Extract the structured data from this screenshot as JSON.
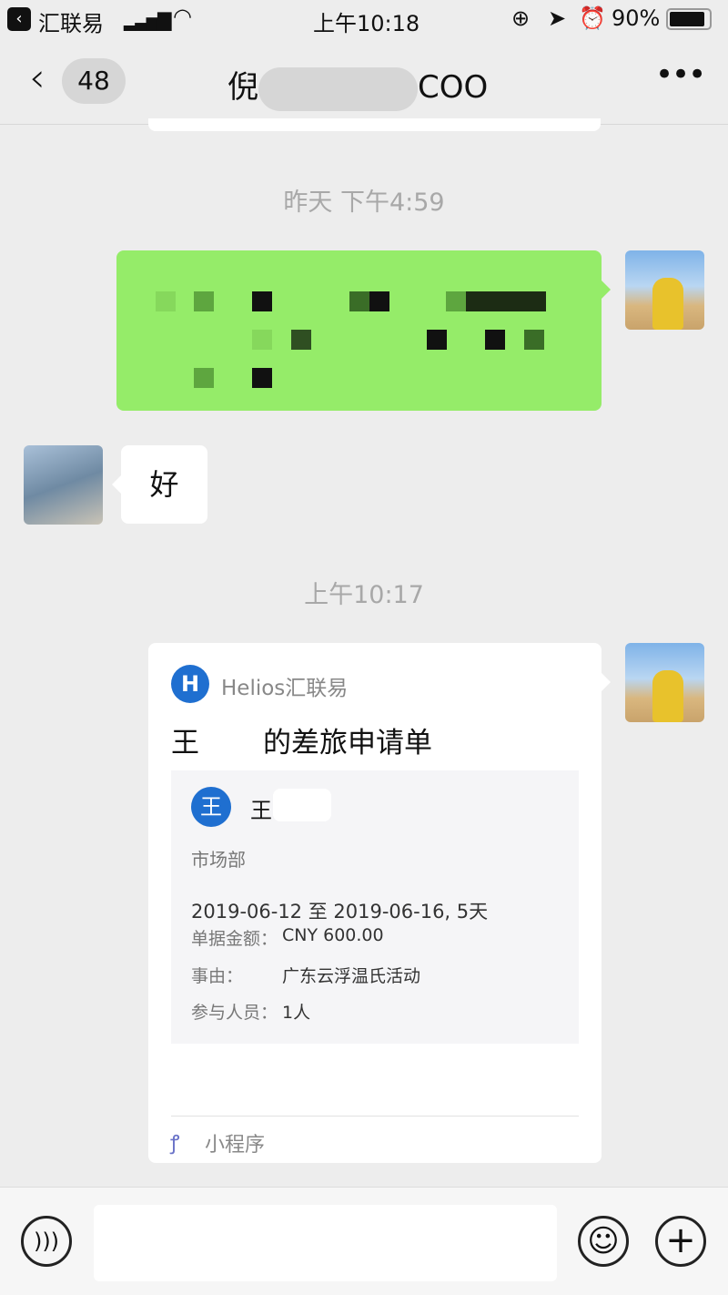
{
  "status_bar": {
    "back_app": "汇联易",
    "time": "上午10:18",
    "battery": "90%"
  },
  "header": {
    "unread_count": "48",
    "title_prefix": "倪",
    "title_suffix": "COO"
  },
  "messages": [
    {
      "type": "timestamp",
      "text": "昨天 下午4:59"
    },
    {
      "type": "text",
      "sender": "me",
      "text": "(pixelated)"
    },
    {
      "type": "text",
      "sender": "other",
      "text": "好"
    },
    {
      "type": "timestamp",
      "text": "上午10:17"
    },
    {
      "type": "mini_program",
      "sender": "me",
      "app_name": "Helios汇联易",
      "app_icon": "H",
      "title_prefix": "王",
      "title_suffix": "的差旅申请单",
      "applicant_initial": "王",
      "applicant_name": "王",
      "department": "市场部",
      "dates": "2019-06-12 至 2019-06-16, 5天",
      "amount_label": "单据金额：",
      "amount": "CNY 600.00",
      "reason_label": "事由：",
      "reason": "广东云浮温氏活动",
      "participants_label": "参与人员：",
      "participants": "1人",
      "footer": "小程序"
    }
  ],
  "colors": {
    "bubble_me": "#95ec69",
    "accent_blue": "#1f6fd0",
    "background": "#ededed"
  }
}
